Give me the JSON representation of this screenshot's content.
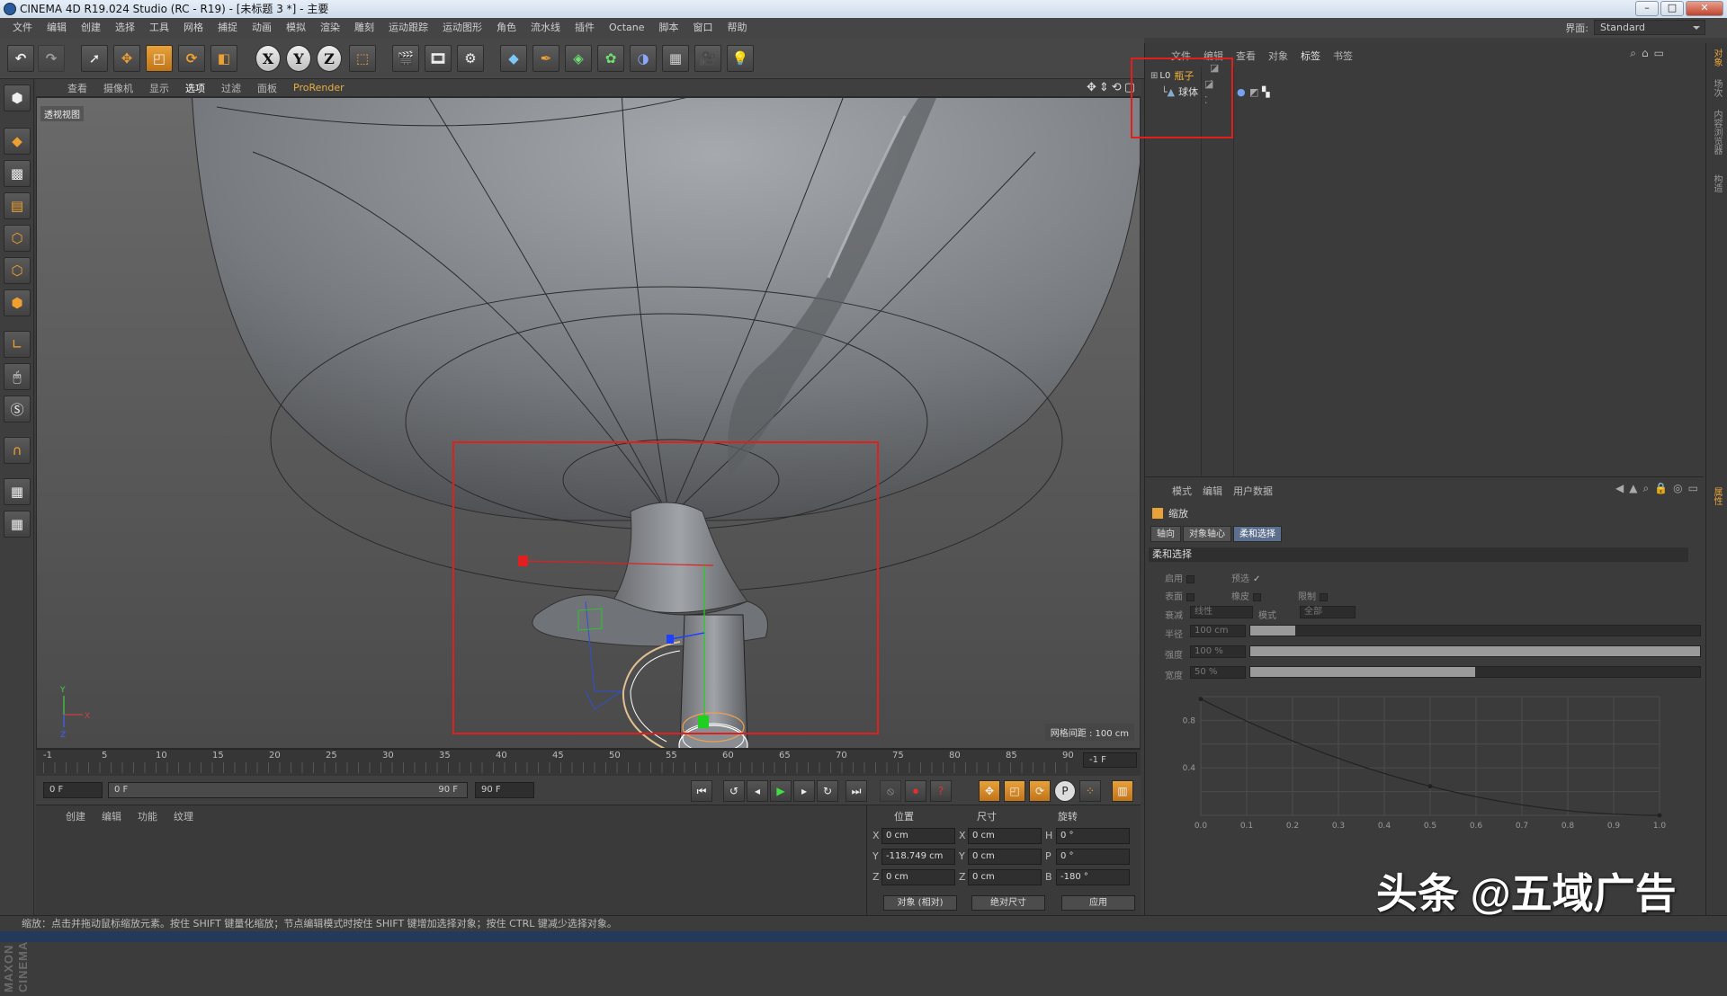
{
  "window": {
    "title": "CINEMA 4D R19.024 Studio (RC - R19) - [未标题 3 *] - 主要"
  },
  "menubar": {
    "items": [
      "文件",
      "编辑",
      "创建",
      "选择",
      "工具",
      "网格",
      "捕捉",
      "动画",
      "模拟",
      "渲染",
      "雕刻",
      "运动跟踪",
      "运动图形",
      "角色",
      "流水线",
      "插件",
      "Octane",
      "脚本",
      "窗口",
      "帮助"
    ],
    "layout_label": "界面:",
    "layout_value": "Standard"
  },
  "toolbar": {
    "axes": [
      "X",
      "Y",
      "Z"
    ]
  },
  "viewport": {
    "menu": [
      "查看",
      "摄像机",
      "显示",
      "选项",
      "过滤",
      "面板",
      "ProRender"
    ],
    "active_menu": "选项",
    "label": "透视视图",
    "grid_info": "网格间距 : 100 cm",
    "axis_y": "Y",
    "axis_x": "X",
    "axis_z": "Z"
  },
  "timeline": {
    "ticks": [
      "-1",
      "5",
      "10",
      "15",
      "20",
      "25",
      "30",
      "35",
      "40",
      "45",
      "50",
      "55",
      "60",
      "65",
      "70",
      "75",
      "80",
      "85",
      "90"
    ],
    "current": "-1 F"
  },
  "transport": {
    "start": "0 F",
    "range_start": "0 F",
    "range_end": "90 F",
    "end": "90 F"
  },
  "material_menu": [
    "创建",
    "编辑",
    "功能",
    "纹理"
  ],
  "coords": {
    "headers": [
      "位置",
      "尺寸",
      "旋转"
    ],
    "rows": [
      {
        "axis": "X",
        "pos": "0 cm",
        "size_axis": "X",
        "size": "0 cm",
        "rot_axis": "H",
        "rot": "0 °"
      },
      {
        "axis": "Y",
        "pos": "-118.749 cm",
        "size_axis": "Y",
        "size": "0 cm",
        "rot_axis": "P",
        "rot": "0 °"
      },
      {
        "axis": "Z",
        "pos": "0 cm",
        "size_axis": "Z",
        "size": "0 cm",
        "rot_axis": "B",
        "rot": "-180 °"
      }
    ],
    "mode": "对象 (相对)",
    "size_mode": "绝对尺寸",
    "apply": "应用"
  },
  "object_manager": {
    "menu": [
      "文件",
      "编辑",
      "查看",
      "对象",
      "标签",
      "书签"
    ],
    "objects": [
      {
        "name": "瓶子",
        "type": "null",
        "color": "#f0b030"
      },
      {
        "name": "球体",
        "type": "sphere",
        "color": "#c8c8c8"
      }
    ]
  },
  "attribute_manager": {
    "menu": [
      "模式",
      "编辑",
      "用户数据"
    ],
    "title": "缩放",
    "tabs": [
      "轴向",
      "对象轴心",
      "柔和选择"
    ],
    "active_tab": "柔和选择",
    "section": "柔和选择",
    "enable_label": "启用",
    "preview_label": "预选",
    "preview_check": "✓",
    "surface_label": "表面",
    "rubber_label": "橡皮",
    "limit_label": "限制",
    "falloff_label": "衰减",
    "falloff_value": "线性",
    "mode_label": "模式",
    "mode_value": "全部",
    "radius_label": "半径",
    "radius_value": "100 cm",
    "radius_fill": 0.1,
    "strength_label": "强度",
    "strength_value": "100 %",
    "strength_fill": 1.0,
    "width_label": "宽度",
    "width_value": "50 %",
    "width_fill": 0.5,
    "graph_y": [
      "0.8",
      "0.4"
    ],
    "graph_x": [
      "0.0",
      "0.1",
      "0.2",
      "0.3",
      "0.4",
      "0.5",
      "0.6",
      "0.7",
      "0.8",
      "0.9",
      "1.0"
    ]
  },
  "right_tabs": [
    "对象",
    "场次",
    "内容浏览器",
    "构造"
  ],
  "right_tabs_attr": "属性",
  "status": "缩放：点击并拖动鼠标缩放元素。按住 SHIFT 键量化缩放；节点编辑模式时按住 SHIFT 键增加选择对象；按住 CTRL 键减少选择对象。",
  "brand": {
    "line1": "MAXON",
    "line2": "CINEMA 4D"
  },
  "watermark": "头条 @五域广告",
  "colors": {
    "accent": "#e9a23a",
    "highlight_box": "#e0201c",
    "selection_tab": "#5c6f8d"
  }
}
